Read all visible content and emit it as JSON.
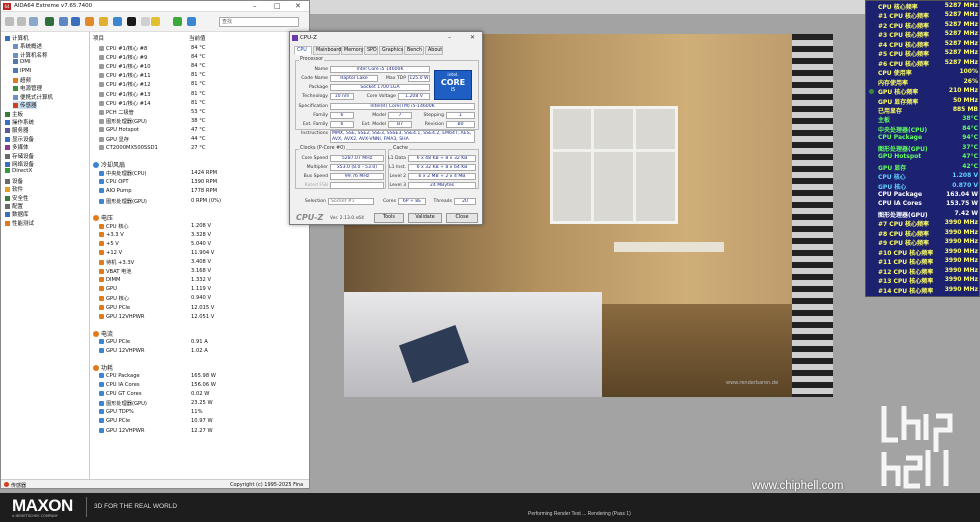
{
  "cinebench": {
    "brand": "MAXON",
    "brand_sub": "A NEMETSCHEK COMPANY",
    "tagline": "3D FOR THE REAL WORLD",
    "status": "Performing Render Test ... Rendering (Pass 1)",
    "render_watermark": "www.renderbaron.de",
    "site_url": "www.chiphell.com"
  },
  "aida": {
    "title": "AIDA64 Extreme v7.65.7400",
    "search_placeholder": "查找",
    "header": {
      "item": "项目",
      "value": "当前值"
    },
    "tree": [
      {
        "label": "计算机",
        "level": 0,
        "color": "#3a6fc0"
      },
      {
        "label": "系统概述",
        "level": 1,
        "color": "#6d8fc2"
      },
      {
        "label": "计算机名称",
        "level": 1,
        "color": "#6d8fc2"
      },
      {
        "label": "DMI",
        "level": 1,
        "color": "#4d7bb0"
      },
      {
        "label": "IPMI",
        "level": 1,
        "color": "#4d7bb0"
      },
      {
        "label": "超频",
        "level": 1,
        "color": "#e07a1f"
      },
      {
        "label": "电源管理",
        "level": 1,
        "color": "#3e8e3e"
      },
      {
        "label": "便携式计算机",
        "level": 1,
        "color": "#6d8fc2"
      },
      {
        "label": "传感器",
        "level": 1,
        "color": "#d04020",
        "selected": true
      },
      {
        "label": "主板",
        "level": 0,
        "color": "#3a7a3a"
      },
      {
        "label": "操作系统",
        "level": 0,
        "color": "#3a6fc0"
      },
      {
        "label": "服务器",
        "level": 0,
        "color": "#5a5a9a"
      },
      {
        "label": "显示设备",
        "level": 0,
        "color": "#3a6fc0"
      },
      {
        "label": "多媒体",
        "level": 0,
        "color": "#8a3a8a"
      },
      {
        "label": "存储设备",
        "level": 0,
        "color": "#6a6a6a"
      },
      {
        "label": "网络设备",
        "level": 0,
        "color": "#3a6fc0"
      },
      {
        "label": "DirectX",
        "level": 0,
        "color": "#3a9a3a"
      },
      {
        "label": "设备",
        "level": 0,
        "color": "#6a6a6a"
      },
      {
        "label": "软件",
        "level": 0,
        "color": "#e0a020"
      },
      {
        "label": "安全性",
        "level": 0,
        "color": "#3a7a3a"
      },
      {
        "label": "配置",
        "level": 0,
        "color": "#6a6a6a"
      },
      {
        "label": "数据库",
        "level": 0,
        "color": "#3a6fc0"
      },
      {
        "label": "性能测试",
        "level": 0,
        "color": "#e07a1f"
      }
    ],
    "temps_top": [
      {
        "name": "CPU #1/核心 #8",
        "value": "84 °C"
      },
      {
        "name": "CPU #1/核心 #9",
        "value": "84 °C"
      },
      {
        "name": "CPU #1/核心 #10",
        "value": "84 °C"
      },
      {
        "name": "CPU #1/核心 #11",
        "value": "81 °C"
      },
      {
        "name": "CPU #1/核心 #12",
        "value": "81 °C"
      },
      {
        "name": "CPU #1/核心 #13",
        "value": "81 °C"
      },
      {
        "name": "CPU #1/核心 #14",
        "value": "81 °C"
      },
      {
        "name": "PCH 二极管",
        "value": "53 °C"
      },
      {
        "name": "图形处理器(GPU)",
        "value": "38 °C"
      },
      {
        "name": "GPU Hotspot",
        "value": "47 °C"
      },
      {
        "name": "GPU 显存",
        "value": "44 °C"
      },
      {
        "name": "CT2000MX500SSD1",
        "value": "27 °C"
      }
    ],
    "fans_title": "冷却风扇",
    "fans": [
      {
        "name": "中央处理器(CPU)",
        "value": "1424 RPM"
      },
      {
        "name": "CPU OPT",
        "value": "1390 RPM"
      },
      {
        "name": "AIO Pump",
        "value": "1778 RPM"
      },
      {
        "name": "图形处理器(GPU)",
        "value": "0 RPM  (0%)"
      }
    ],
    "volts_title": "电压",
    "volts": [
      {
        "name": "CPU 核心",
        "value": "1.208 V"
      },
      {
        "name": "+3.3 V",
        "value": "3.328 V"
      },
      {
        "name": "+5 V",
        "value": "5.040 V"
      },
      {
        "name": "+12 V",
        "value": "11.904 V"
      },
      {
        "name": "待机 +3.3V",
        "value": "3.408 V"
      },
      {
        "name": "VBAT 电池",
        "value": "3.168 V"
      },
      {
        "name": "DIMM",
        "value": "1.332 V"
      },
      {
        "name": "GPU",
        "value": "1.119 V"
      },
      {
        "name": "GPU 核心",
        "value": "0.940 V"
      },
      {
        "name": "GPU PCIe",
        "value": "12.015 V"
      },
      {
        "name": "GPU 12VHPWR",
        "value": "12.051 V"
      }
    ],
    "current_title": "电流",
    "current": [
      {
        "name": "GPU PCIe",
        "value": "0.91 A"
      },
      {
        "name": "GPU 12VHPWR",
        "value": "1.02 A"
      }
    ],
    "power_title": "功耗",
    "power": [
      {
        "name": "CPU Package",
        "value": "165.98 W"
      },
      {
        "name": "CPU IA Cores",
        "value": "156.06 W"
      },
      {
        "name": "CPU GT Cores",
        "value": "0.02 W"
      },
      {
        "name": "图形处理器(GPU)",
        "value": "23.25 W"
      },
      {
        "name": "GPU TDP%",
        "value": "11%"
      },
      {
        "name": "GPU PCIe",
        "value": "10.97 W"
      },
      {
        "name": "GPU 12VHPWR",
        "value": "12.27 W"
      }
    ],
    "status_left": "传感器",
    "status_right": "Copyright (c) 1995-2025 Fina"
  },
  "cpuz": {
    "title": "CPU-Z",
    "tabs": [
      "CPU",
      "Mainboard",
      "Memory",
      "SPD",
      "Graphics",
      "Bench",
      "About"
    ],
    "processor_label": "Processor",
    "name_label": "Name",
    "name": "Intel Core i5 14600K",
    "codename_label": "Code Name",
    "codename": "Raptor Lake",
    "maxtdp_label": "Max TDP",
    "maxtdp": "125.0 W",
    "package_label": "Package",
    "package": "Socket 1700 LGA",
    "tech_label": "Technology",
    "tech": "10 nm",
    "corevolt_label": "Core Voltage",
    "corevolt": "1.208 V",
    "spec_label": "Specification",
    "spec": "Intel(R) Core(TM) i5-14600K",
    "family_label": "Family",
    "family": "6",
    "model_label": "Model",
    "model": "7",
    "stepping_label": "Stepping",
    "stepping": "1",
    "extfamily_label": "Ext. Family",
    "extfamily": "6",
    "extmodel_label": "Ext. Model",
    "extmodel": "B7",
    "revision_label": "Revision",
    "revision": "B0",
    "instr_label": "Instructions",
    "instr": "MMX, SSE, SSE2, SSE3, SSSE3, SSE4.1, SSE4.2, EM64T, AES, AVX, AVX2, AVX-VNNI, FMA3, SHA",
    "clocks_label": "Clocks (P-Core #0)",
    "corespeed_label": "Core Speed",
    "corespeed": "5287.07 MHz",
    "multiplier_label": "Multiplier",
    "multiplier": "x53.0 (8.0 - 53.0)",
    "busspeed_label": "Bus Speed",
    "busspeed": "99.76 MHz",
    "ratedfsb_label": "Rated FSB",
    "cache_label": "Cache",
    "l1d_label": "L1 Data",
    "l1d": "6 x 48 KB + 8 x 32 KB",
    "l1i_label": "L1 Inst.",
    "l1i": "6 x 32 KB + 8 x 64 KB",
    "l2_label": "Level 2",
    "l2": "6 x 2 MB + 2 x 4 MB",
    "l3_label": "Level 3",
    "l3": "24 MBytes",
    "selection_label": "Selection",
    "selection": "Socket #1",
    "cores_label": "Cores",
    "cores": "6P + 8E",
    "threads_label": "Threads",
    "threads": "20",
    "brand": "CPU-Z",
    "version": "Ver. 2.13.0.x64",
    "tools_btn": "Tools",
    "validate_btn": "Validate",
    "close_btn": "Close",
    "intel_top": "intel.",
    "intel_mid": "CORE",
    "intel_bot": "i5"
  },
  "osd": {
    "rows": [
      {
        "k": "CPU 核心频率",
        "v": "5287 MHz",
        "c": "#ffff60"
      },
      {
        "k": "#1 CPU 核心频率",
        "v": "5287 MHz",
        "c": "#ffff60"
      },
      {
        "k": "#2 CPU 核心频率",
        "v": "5287 MHz",
        "c": "#ffff60"
      },
      {
        "k": "#3 CPU 核心频率",
        "v": "5287 MHz",
        "c": "#ffff60"
      },
      {
        "k": "#4 CPU 核心频率",
        "v": "5287 MHz",
        "c": "#ffff60"
      },
      {
        "k": "#5 CPU 核心频率",
        "v": "5287 MHz",
        "c": "#ffff60"
      },
      {
        "k": "#6 CPU 核心频率",
        "v": "5287 MHz",
        "c": "#ffff60"
      },
      {
        "k": "CPU 使用率",
        "v": "100%",
        "c": "#ffff60"
      },
      {
        "k": "内存使用率",
        "v": "26%",
        "c": "#ffff60"
      },
      {
        "k": "GPU 核心频率",
        "v": "210 MHz",
        "c": "#ffff60",
        "dot": true
      },
      {
        "k": "GPU 显存频率",
        "v": "50 MHz",
        "c": "#ffff60"
      },
      {
        "k": "已用显存",
        "v": "885 MB",
        "c": "#ffff60"
      },
      {
        "k": "主板",
        "v": "38°C",
        "c": "#60ff60"
      },
      {
        "k": "中央处理器(CPU)",
        "v": "84°C",
        "c": "#60ff60"
      },
      {
        "k": "CPU Package",
        "v": "94°C",
        "c": "#60ff60"
      },
      {
        "k": "图形处理器(GPU)",
        "v": "37°C",
        "c": "#60ff60"
      },
      {
        "k": "GPU Hotspot",
        "v": "47°C",
        "c": "#60ff60"
      },
      {
        "k": "GPU 显存",
        "v": "42°C",
        "c": "#60ff60"
      },
      {
        "k": "CPU 核心",
        "v": "1.208 V",
        "c": "#60d0ff"
      },
      {
        "k": "GPU 核心",
        "v": "0.870 V",
        "c": "#60d0ff"
      },
      {
        "k": "CPU Package",
        "v": "163.04 W",
        "c": "#ffffff"
      },
      {
        "k": "CPU IA Cores",
        "v": "153.75 W",
        "c": "#ffffff"
      },
      {
        "k": "图形处理器(GPU)",
        "v": "7.42 W",
        "c": "#ffffff"
      },
      {
        "k": "#7 CPU 核心频率",
        "v": "3990 MHz",
        "c": "#ffff60"
      },
      {
        "k": "#8 CPU 核心频率",
        "v": "3990 MHz",
        "c": "#ffff60"
      },
      {
        "k": "#9 CPU 核心频率",
        "v": "3990 MHz",
        "c": "#ffff60"
      },
      {
        "k": "#10 CPU 核心频率",
        "v": "3990 MHz",
        "c": "#ffff60"
      },
      {
        "k": "#11 CPU 核心频率",
        "v": "3990 MHz",
        "c": "#ffff60"
      },
      {
        "k": "#12 CPU 核心频率",
        "v": "3990 MHz",
        "c": "#ffff60"
      },
      {
        "k": "#13 CPU 核心频率",
        "v": "3990 MHz",
        "c": "#ffff60"
      },
      {
        "k": "#14 CPU 核心频率",
        "v": "3990 MHz",
        "c": "#ffff60"
      }
    ]
  }
}
